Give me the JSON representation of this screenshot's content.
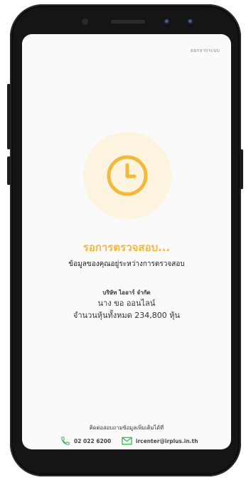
{
  "header": {
    "logout_label": "ออกจากระบบ"
  },
  "status": {
    "icon": "clock-icon",
    "title": "รอการตรวจสอบ...",
    "message": "ข้อมูลของคุณอยู่ระหว่างการตรวจสอบ"
  },
  "account": {
    "company": "บริษัท ไออาร์ จำกัด",
    "name": "นาง ขอ ออนไลน์",
    "shares_text": "จำนวนหุ้นทั้งหมด 234,800 หุ้น"
  },
  "contact": {
    "caption": "ติดต่อสอบถามข้อมูลเพิ่มเติมได้ที่",
    "phone": "02 022 6200",
    "email": "ircenter@irplus.in.th"
  },
  "colors": {
    "accent": "#f2b93a",
    "halo": "#fdf4df",
    "contact_icon": "#35b54a",
    "phone_body": "#151516",
    "screen_background": "#fafafa"
  }
}
